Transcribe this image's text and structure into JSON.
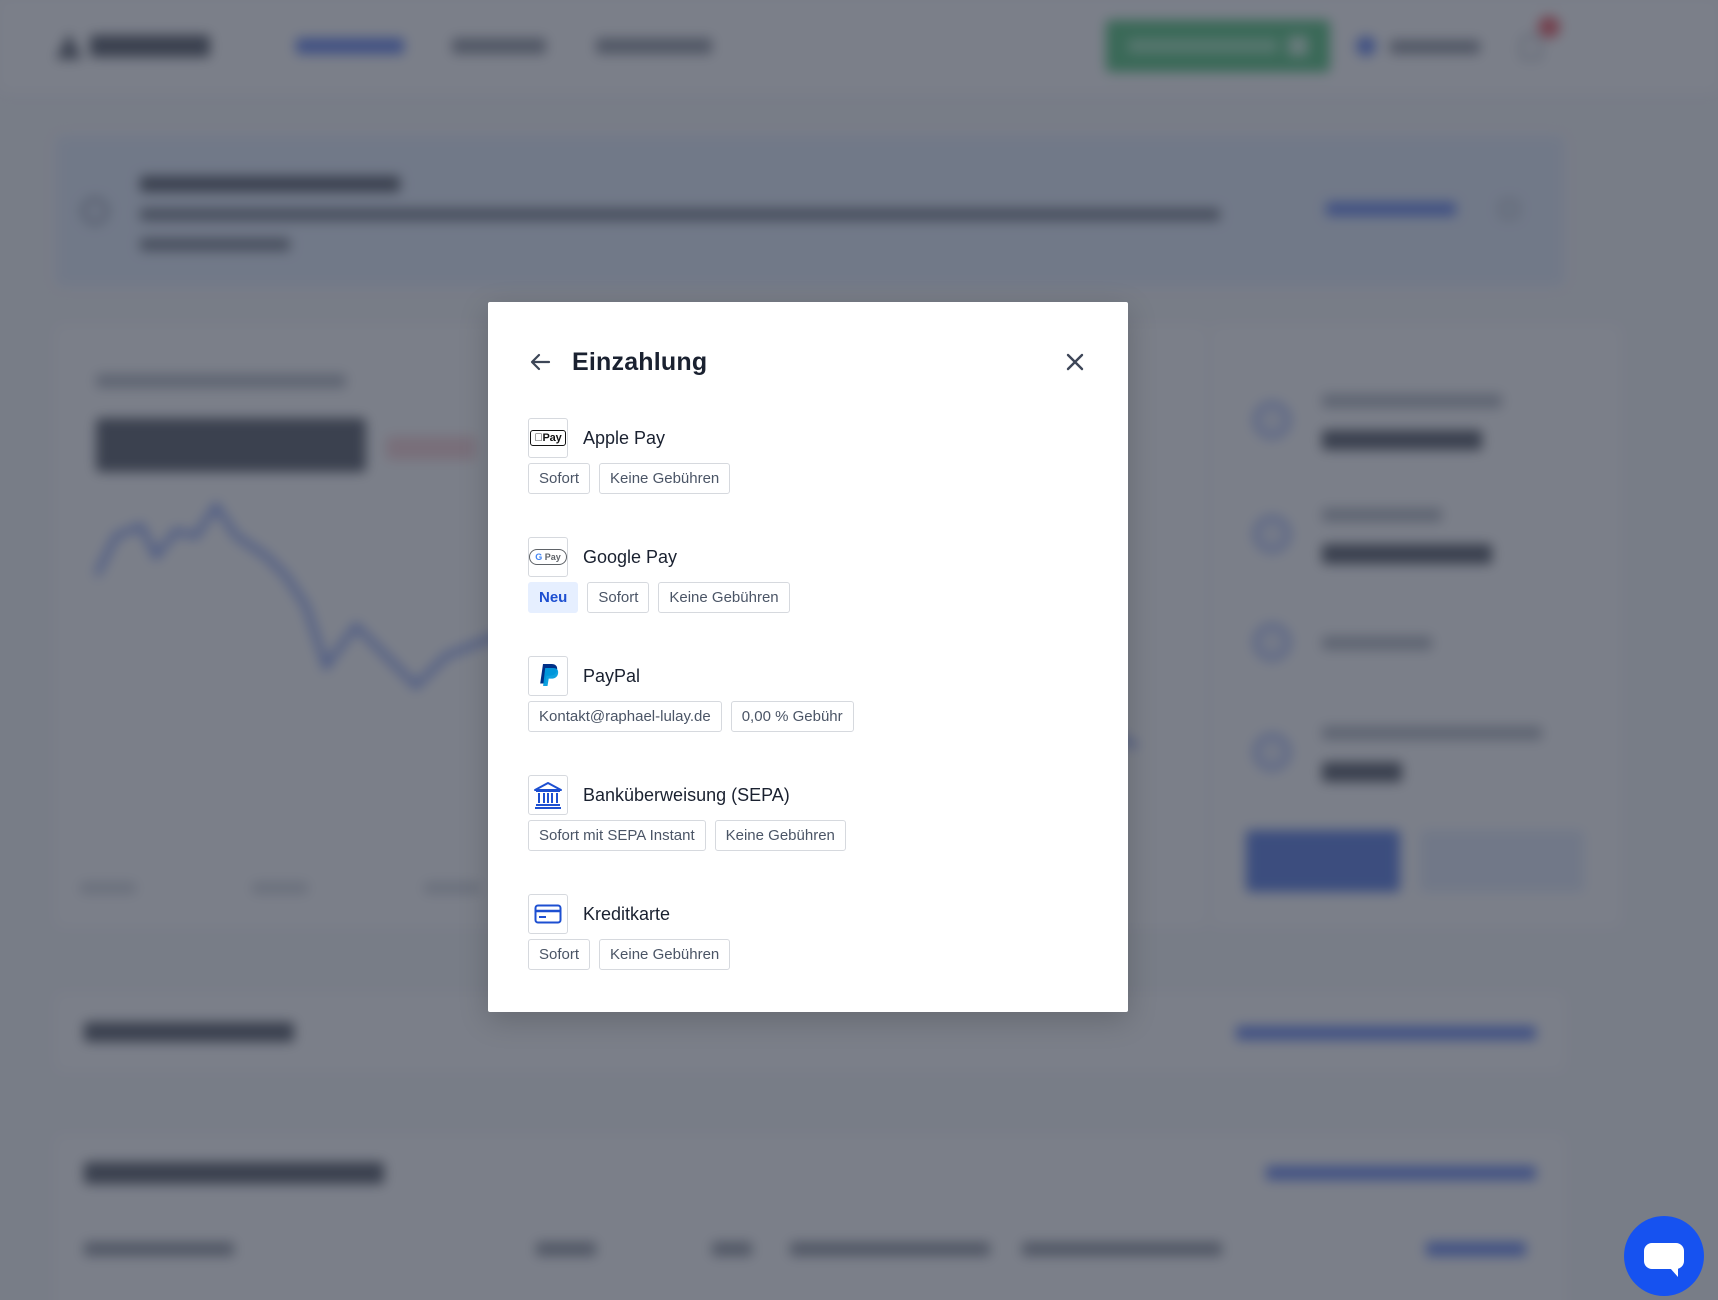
{
  "modal": {
    "title": "Einzahlung",
    "methods": [
      {
        "name": "Apple Pay",
        "logo_icon": "apple-pay-icon",
        "logo_text": "Pay",
        "tags": [
          "Sofort",
          "Keine Gebühren"
        ]
      },
      {
        "name": "Google Pay",
        "logo_icon": "google-pay-icon",
        "logo_text_g": "G",
        "logo_text": "Pay",
        "badge": "Neu",
        "tags": [
          "Sofort",
          "Keine Gebühren"
        ]
      },
      {
        "name": "PayPal",
        "logo_icon": "paypal-icon",
        "tags": [
          "Kontakt@raphael-lulay.de",
          "0,00 % Gebühr"
        ]
      },
      {
        "name": "Banküberweisung (SEPA)",
        "logo_icon": "bank-icon",
        "tags": [
          "Sofort mit SEPA Instant",
          "Keine Gebühren"
        ]
      },
      {
        "name": "Kreditkarte",
        "logo_icon": "credit-card-icon",
        "tags": [
          "Sofort",
          "Keine Gebühren"
        ]
      }
    ]
  },
  "colors": {
    "accent": "#1d4fd1",
    "chat_button": "#1652f0",
    "overlay": "#484e5c"
  }
}
